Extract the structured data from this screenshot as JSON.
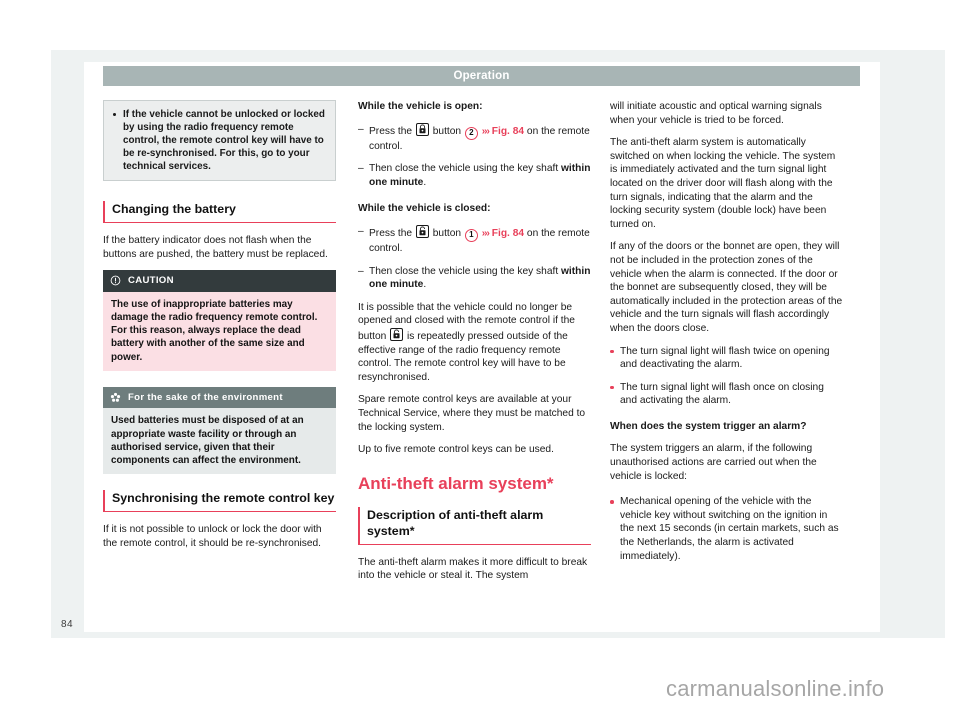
{
  "header": {
    "running_title": "Operation"
  },
  "folio": {
    "page_number": "84"
  },
  "watermark": {
    "text": "carmanualsonline.info"
  },
  "column_1": {
    "note_box": {
      "bullet_text": "If the vehicle cannot be unlocked or locked by using the radio frequency remote control, the remote control key will have to be re-synchronised. For this, go to your technical services."
    },
    "section_battery": {
      "heading": "Changing the battery",
      "paragraph": "If the battery indicator does not flash when the buttons are pushed, the battery must be replaced."
    },
    "caution_panel": {
      "title": "CAUTION",
      "icon": "exclamation-circle-icon",
      "body": "The use of inappropriate batteries may damage the radio frequency remote control. For this reason, always replace the dead battery with another of the same size and power."
    },
    "environment_panel": {
      "title": "For the sake of the environment",
      "icon": "environment-flower-icon",
      "body": "Used batteries must be disposed of at an appropriate waste facility or through an authorised service, given that their components can affect the environment."
    },
    "section_sync": {
      "heading": "Synchronising the remote control key",
      "paragraph": "If it is not possible to unlock or lock the door with the remote control, it should be re-synchronised."
    }
  },
  "column_2": {
    "vehicle_open": {
      "subheading": "While the vehicle is open:",
      "step_1_prefix": "Press the",
      "step_1_icon": "padlock-closed-icon",
      "step_1_mid": "button",
      "step_1_callout": "2",
      "step_1_arrows": "›››",
      "step_1_ref": "Fig. 84",
      "step_1_suffix": "on the remote control.",
      "step_2_plain": "Then close the vehicle using the key shaft",
      "step_2_bold": "within one minute",
      "step_2_end": "."
    },
    "vehicle_closed": {
      "subheading": "While the vehicle is closed:",
      "step_1_prefix": "Press the",
      "step_1_icon": "padlock-open-icon",
      "step_1_mid": "button",
      "step_1_callout": "1",
      "step_1_arrows": "›››",
      "step_1_ref": "Fig. 84",
      "step_1_suffix": "on the remote control.",
      "step_2_plain": "Then close the vehicle using the key shaft",
      "step_2_bold": "within one minute",
      "step_2_end": "."
    },
    "paragraph_resync_pre": "It is possible that the vehicle could no longer be opened and closed with the remote control if the button",
    "paragraph_resync_icon": "padlock-open-icon",
    "paragraph_resync_post": "is repeatedly pressed outside of the effective range of the radio frequency remote control. The remote control key will have to be resynchronised.",
    "paragraph_spare": "Spare remote control keys are available at your Technical Service, where they must be matched to the locking system.",
    "paragraph_five": "Up to five remote control keys can be used.",
    "chapter_title": "Anti-theft alarm system*",
    "section_description": {
      "heading": "Description of anti-theft alarm system*",
      "paragraph": "The anti-theft alarm makes it more difficult to break into the vehicle or steal it. The system"
    }
  },
  "column_3": {
    "paragraph_continued": "will initiate acoustic and optical warning signals when your vehicle is tried to be forced.",
    "paragraph_auto": "The anti-theft alarm system is automatically switched on when locking the vehicle. The system is immediately activated and the turn signal light located on the driver door will flash along with the turn signals, indicating that the alarm and the locking security system (double lock) have been turned on.",
    "paragraph_doors": "If any of the doors or the bonnet are open, they will not be included in the protection zones of the vehicle when the alarm is connected. If the door or the bonnet are subsequently closed, they will be automatically included in the protection areas of the vehicle and the turn signals will flash accordingly when the doors close.",
    "bullets": [
      "The turn signal light will flash twice on opening and deactivating the alarm.",
      "The turn signal light will flash once on closing and activating the alarm."
    ],
    "trigger_subheading": "When does the system trigger an alarm?",
    "trigger_paragraph": "The system triggers an alarm, if the following unauthorised actions are carried out when the vehicle is locked:",
    "trigger_bullets": [
      "Mechanical opening of the vehicle with the vehicle key without switching on the ignition in the next 15 seconds (in certain markets, such as the Netherlands, the alarm is activated immediately)."
    ]
  },
  "colors": {
    "accent_red": "#e8405a",
    "running_head_bg": "#a8b5b5",
    "caution_header_bg": "#333b3d",
    "caution_body_bg": "#fbdfe4",
    "env_header_bg": "#6e7d7d",
    "env_body_bg": "#e6eaea"
  }
}
